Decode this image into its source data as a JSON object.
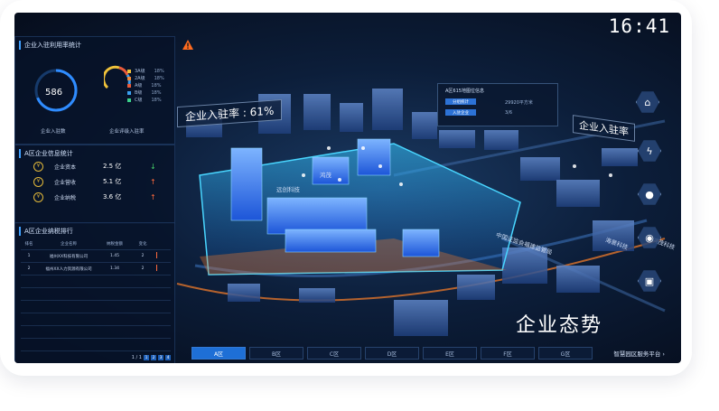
{
  "clock": "16:41",
  "panel1": {
    "title": "企业入驻利用率统计",
    "ring_value": "586",
    "ring_label": "企业入驻数",
    "gauge_label": "企业评级入驻率",
    "legend": [
      {
        "label": "3A级",
        "pct": "18%",
        "color": "#f0c23a"
      },
      {
        "label": "2A级",
        "pct": "18%",
        "color": "#f08a3a"
      },
      {
        "label": "A级",
        "pct": "18%",
        "color": "#e85a3a"
      },
      {
        "label": "B级",
        "pct": "18%",
        "color": "#3a9ff0"
      },
      {
        "label": "C级",
        "pct": "18%",
        "color": "#3ad08a"
      }
    ]
  },
  "panel2": {
    "title": "A区企业信息统计",
    "rows": [
      {
        "name": "企业资本",
        "value": "2.5 亿",
        "trend": "down"
      },
      {
        "name": "企业营收",
        "value": "5.1 亿",
        "trend": "up"
      },
      {
        "name": "企业纳税",
        "value": "3.6 亿",
        "trend": "up"
      }
    ]
  },
  "panel3": {
    "title": "A区企业纳税排行",
    "headers": [
      "排名",
      "企业名称",
      "纳税金额",
      "变化"
    ],
    "rows": [
      {
        "rank": "1",
        "name": "福州XX科技有限公司",
        "amount": "1.45",
        "change": "2"
      },
      {
        "rank": "2",
        "name": "福州XX人力资源有限公司",
        "amount": "1.34",
        "change": "2"
      }
    ],
    "pager": {
      "text": "1 / 1",
      "pages": [
        "1",
        "2",
        "3",
        "4"
      ]
    }
  },
  "scene": {
    "rate_tag": "企业入驻率 : 61%",
    "rate_tag_right": "企业入驻率",
    "info_card": {
      "title": "A区615地图位信息",
      "btn1": "分组统计",
      "btn2": "入驻企业",
      "val1": "29920平方米",
      "val2": "3/6"
    },
    "streets": [
      "中国证监会福建监管局",
      "海景科技",
      "鸿茂科技"
    ],
    "building_labels": [
      "远创科技",
      "鸿茂"
    ],
    "big_title": "企业态势"
  },
  "tabs": [
    "A区",
    "B区",
    "C区",
    "D区",
    "E区",
    "F区",
    "G区"
  ],
  "active_tab": "A区",
  "platform": "智慧园区服务平台"
}
